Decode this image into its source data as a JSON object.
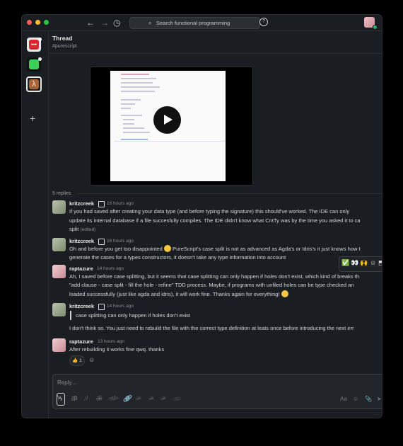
{
  "colors": {
    "accent": "#2bac76",
    "window": "#1a1d21",
    "traffic_red": "#ff5f57",
    "traffic_yellow": "#febc2e",
    "traffic_green": "#28c840"
  },
  "titlebar": {
    "back_icon": "arrow-left-icon",
    "forward_icon": "arrow-right-icon",
    "history_icon": "clock-icon",
    "search_placeholder": "Search functional programming",
    "help_icon": "help-circle-icon"
  },
  "sidebar": {
    "workspaces": [
      {
        "name": "workspace-red"
      },
      {
        "name": "workspace-green"
      },
      {
        "name": "workspace-lambda",
        "glyph": "λ"
      }
    ],
    "add_label": "+"
  },
  "thread": {
    "title": "Thread",
    "channel": "#purescript",
    "replies_label": "5 replies"
  },
  "messages": [
    {
      "author": "kritzcreek",
      "time": "16 hours ago",
      "lines": [
        "If you had saved after creating your data type (and before typing the signature) this should've worked. The IDE can only",
        "update its internal database if a file succesfully compiles. The IDE didn't know what CntTy was by the time you asked it to ca",
        "split"
      ],
      "edited": "(edited)"
    },
    {
      "author": "kritzcreek",
      "time": "16 hours ago",
      "line1_pre": "Oh and before you get too disappointed ",
      "line1_post": " PureScript's case split is not as advanced as Agda's or Idris's it just knows how t",
      "line2": "generate the cases for a types constructors, it doesn't take any type information into account"
    },
    {
      "author": "raptazure",
      "time": "14 hours ago",
      "lines": [
        "Ah, I saved before case splitting, but it seems that case splitting can only happen if holes don't exist, which kind of breaks th",
        "\"add clause - case split - fill the hole  - refine\"  TDD process.  Maybe, if programs with unfiled holes can be type checked an"
      ],
      "line3_pre": "loaded successfully (just like agda and idris), it will work fine. Thanks again for everything! "
    },
    {
      "author": "kritzcreek",
      "time": "14 hours ago",
      "quote": "case splitting can only happen if holes don't exist",
      "line": "I don't think so. You just need to rebuild the file with the correct type definition at leats once before introducing the next err"
    },
    {
      "author": "raptazure",
      "time": "13 hours ago",
      "line": "After rebuilding it works fine qwq. thanks",
      "reaction": "1",
      "reaction_emoji": "👍"
    }
  ],
  "hover_actions": [
    "✅",
    "👀",
    "🙌",
    "☺",
    "⬒",
    "⋮"
  ],
  "composer": {
    "placeholder": "Reply...",
    "tools": [
      "B",
      "I",
      "S",
      "</>",
      "🔗",
      "≡",
      "≡",
      "≡",
      "▭"
    ],
    "right_tools": [
      "Aa",
      "☺",
      "📎",
      "➤"
    ]
  },
  "ghost_toolbar": [
    "B",
    "I",
    "S",
    "</>",
    "🔗",
    "≡",
    "≡",
    "≡",
    "▭"
  ]
}
